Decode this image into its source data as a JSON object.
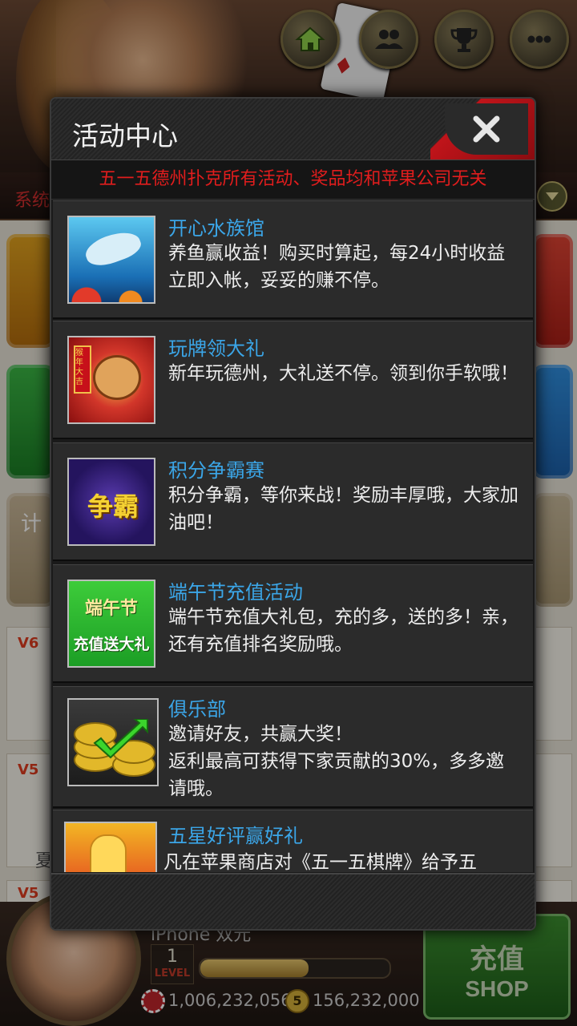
{
  "lobby": {
    "system_text": "系统",
    "top_buttons": [
      {
        "name": "home",
        "icon": "home-icon"
      },
      {
        "name": "friends",
        "icon": "friends-icon"
      },
      {
        "name": "ranking",
        "icon": "trophy-icon"
      },
      {
        "name": "more",
        "icon": "more-icon"
      }
    ],
    "side_text_left": "计",
    "vip_labels": [
      "V6",
      "V5",
      "V5"
    ],
    "row_text_left": "夏",
    "player": {
      "name": "iPhone 双元",
      "level": "1",
      "level_label": "LEVEL",
      "xp_fraction": 0.57,
      "chips": "1,006,232,056",
      "coins": "156,232,000",
      "coin_symbol": "5"
    },
    "shop": {
      "label_cn": "充值",
      "label_en": "SHOP"
    }
  },
  "dialog": {
    "title": "活动中心",
    "notice": "五一五德州扑克所有活动、奖品均和苹果公司无关",
    "items": [
      {
        "title": "开心水族馆",
        "desc": "养鱼赢收益！购买时算起，每24小时收益立即入帐，妥妥的赚不停。",
        "thumb": "aquarium-thumb"
      },
      {
        "title": "玩牌领大礼",
        "desc": "新年玩德州，大礼送不停。领到你手软哦！",
        "thumb": "monkey-thumb",
        "thumb_text": "猴年大吉"
      },
      {
        "title": "积分争霸赛",
        "desc": "积分争霸，等你来战！奖励丰厚哦，大家加油吧！",
        "thumb": "zhengba-thumb",
        "thumb_text": "争霸"
      },
      {
        "title": "端午节充值活动",
        "desc": "端午节充值大礼包，充的多，送的多！亲，还有充值排名奖励哦。",
        "thumb": "duanwu-thumb",
        "thumb_text1": "端午节",
        "thumb_text2": "充值送大礼"
      },
      {
        "title": "俱乐部",
        "desc": "邀请好友，共赢大奖！\n返利最高可获得下家贡献的30%，多多邀请哦。",
        "thumb": "club-thumb"
      },
      {
        "title": "五星好评赢好礼",
        "desc": "凡在苹果商店对《五一五棋牌》给予五",
        "thumb": "review-thumb"
      }
    ]
  },
  "colors": {
    "accent_blue": "#3ba6e8",
    "notice_red": "#e11d1d",
    "dialog_bg": "#2b2b2b"
  }
}
